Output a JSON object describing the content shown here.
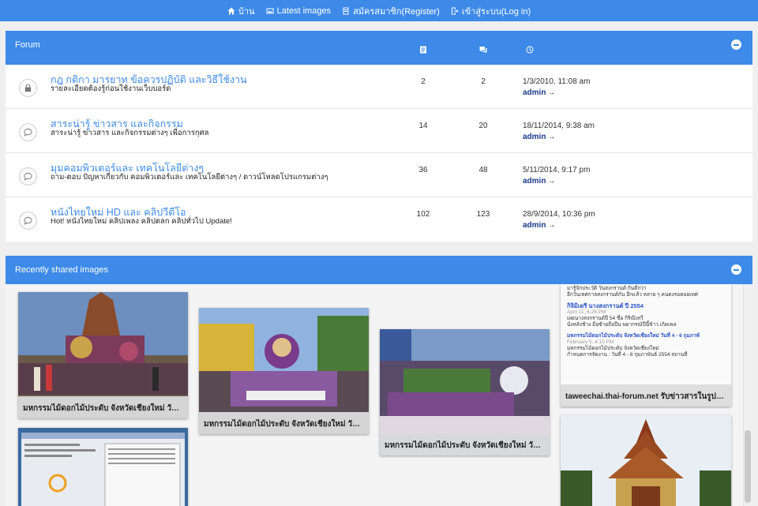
{
  "nav": {
    "home": "บ้าน",
    "latest_images": "Latest images",
    "register": "สมัครสมาชิก(Register)",
    "login": "เข้าสู่ระบบ(Log in)"
  },
  "forum_panel": {
    "title": "Forum",
    "icons": [
      "topics-icon",
      "posts-icon",
      "last-post-clock-icon"
    ],
    "rows": [
      {
        "title": "กฎ กติกา มารยาท ข้อควรปฏิบัติ และวิธีใช้งาน",
        "desc": "รายละเอียดต้องรู้ก่อนใช้งานเว็บบอร์ด",
        "topics": "2",
        "posts": "2",
        "date": "1/3/2010, 11:08 am",
        "user": "admin",
        "icon": "lock-icon"
      },
      {
        "title": "สาระน่ารู้ ข่าวสาร และกิจกรรม",
        "desc": "สาระน่ารู้ ข่าวสาร และกิจกรรมต่างๆ เพื่อการกุศล",
        "topics": "14",
        "posts": "20",
        "date": "18/11/2014, 9:38 am",
        "user": "admin",
        "icon": "speech-bubble-icon"
      },
      {
        "title": "มุมคอมพิวเตอร์และ เทคโนโลยีต่างๆ",
        "desc": "ถาม-ตอบ ปัญหาเกี่ยวกับ คอมพิวเตอร์และ เทคโนโลยีต่างๆ / ดาวน์โหลดโปรแกรมต่างๆ",
        "topics": "36",
        "posts": "48",
        "date": "5/11/2014, 9:17 pm",
        "user": "admin",
        "icon": "speech-bubble-icon"
      },
      {
        "title": "หนังไทยใหม่ HD และ คลิปวีดีโอ",
        "desc": "Hot! หนังไทยใหม่ คลิปเพลง คลิปตลก คลิปทั่วไป Update!",
        "topics": "102",
        "posts": "123",
        "date": "28/9/2014, 10:36 pm",
        "user": "admin",
        "icon": "speech-bubble-icon"
      }
    ]
  },
  "images_panel": {
    "title": "Recently shared images",
    "images": [
      {
        "caption": "มหกรรมไม้ดอกไม้ประดับ จังหวัดเชียงใหม่ วันที่..."
      },
      {
        "caption": "มหกรรมไม้ดอกไม้ประดับ จังหวัดเชียงใหม่ วันที่..."
      },
      {
        "caption": "มหกรรมไม้ดอกไม้ประดับ จังหวัดเชียงใหม่ วันที่..."
      },
      {
        "caption": "taweechai.thai-forum.net รับข่าวสารในรูปแบ...",
        "lines": [
          "มารู้จักประวัติ วันสงกรานต์ กันดีกว่า",
          "อีกวันเทศกาลสงกรานต์กัน อีกแล้ว หลาย ๆ คนคงรอคอยเทศ",
          "กิจิมิเดรี นางสงกรานต์ ปี 2554",
          "April 11, 6:26 PM",
          "เผยนางสงกรานต์ปี 54 ชื่อ กิริณีเทวี",
          "นั่งหลังช้าง มือซ้ายถือปืน พยากรณ์ปีนี้ข้าว เกิดเพล",
          "มหกรรมไม้ดอกไม้ประดับ จังหวัดเชียงใหม่ วันที่ 4 - 6 กุมภาพั",
          "February 5, 4:15 PM",
          "มหกรรมไม้ดอกไม้ประดับ จังหวัดเชียงใหม่",
          "กำหนดการจัดงาน : วันที่ 4 - 6 กุมภาพันธ์ 2554 สถานที่"
        ]
      },
      {
        "caption": ""
      },
      {
        "caption": ""
      }
    ]
  },
  "colors": {
    "accent": "#3d8ae9",
    "link": "#3d8ae9",
    "user": "#1a3a8a"
  }
}
